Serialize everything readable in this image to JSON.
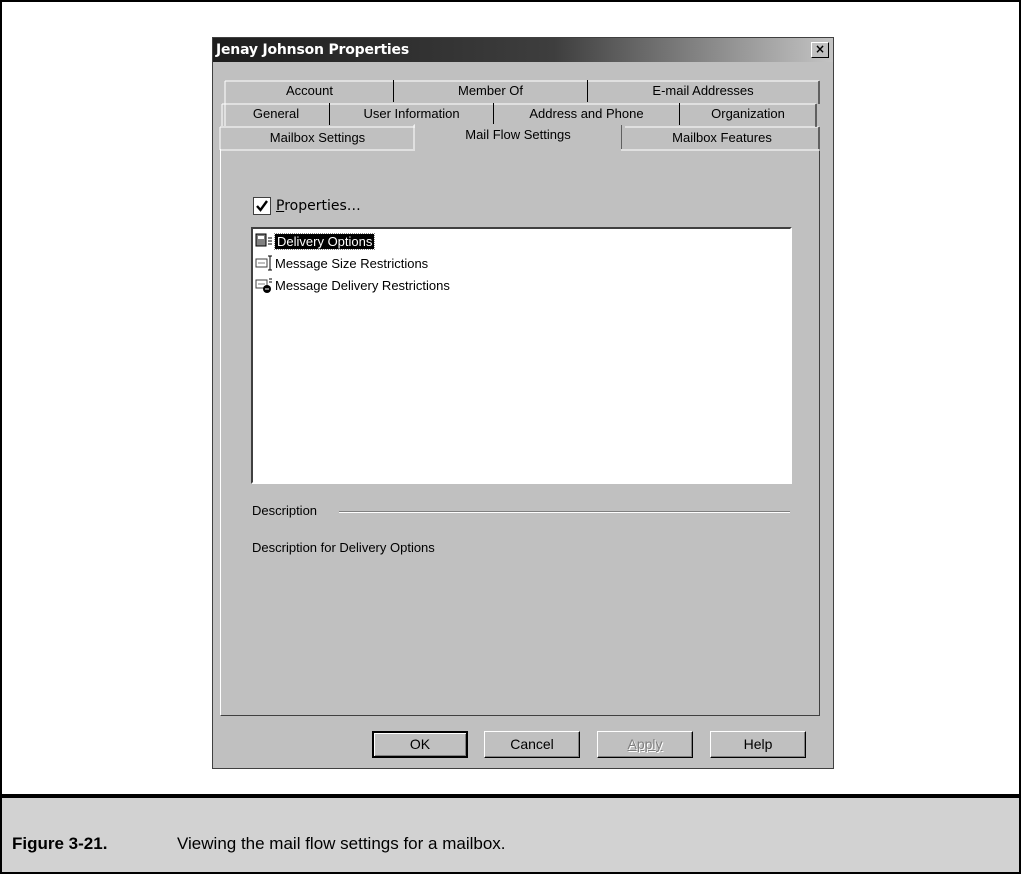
{
  "window": {
    "title": "Jenay Johnson Properties",
    "close_glyph": "×"
  },
  "tabs": {
    "row1": [
      "Account",
      "Member Of",
      "E-mail Addresses"
    ],
    "row2": [
      "General",
      "User Information",
      "Address and Phone",
      "Organization"
    ],
    "row3": [
      "Mailbox Settings",
      "Mail Flow Settings",
      "Mailbox Features"
    ],
    "selected": "Mail Flow Settings"
  },
  "properties_button": {
    "label_underlined": "P",
    "label_rest": "roperties…",
    "checkbox_checked": true
  },
  "list": {
    "items": [
      {
        "label": "Delivery Options",
        "icon": "delivery-options-icon",
        "selected": true
      },
      {
        "label": "Message Size Restrictions",
        "icon": "message-size-icon",
        "selected": false
      },
      {
        "label": "Message Delivery Restrictions",
        "icon": "message-delivery-restrictions-icon",
        "selected": false
      }
    ]
  },
  "description": {
    "heading": "Description",
    "text": "Description for Delivery Options"
  },
  "buttons": {
    "ok": "OK",
    "cancel": "Cancel",
    "apply": "Apply",
    "help": "Help",
    "apply_enabled": false
  },
  "figure": {
    "label": "Figure 3-21.",
    "caption": "Viewing the mail flow settings for a mailbox."
  },
  "colors": {
    "dialog_face": "#c0c0c0",
    "caption_background": "#d2d2d2",
    "selection": "#000000"
  }
}
